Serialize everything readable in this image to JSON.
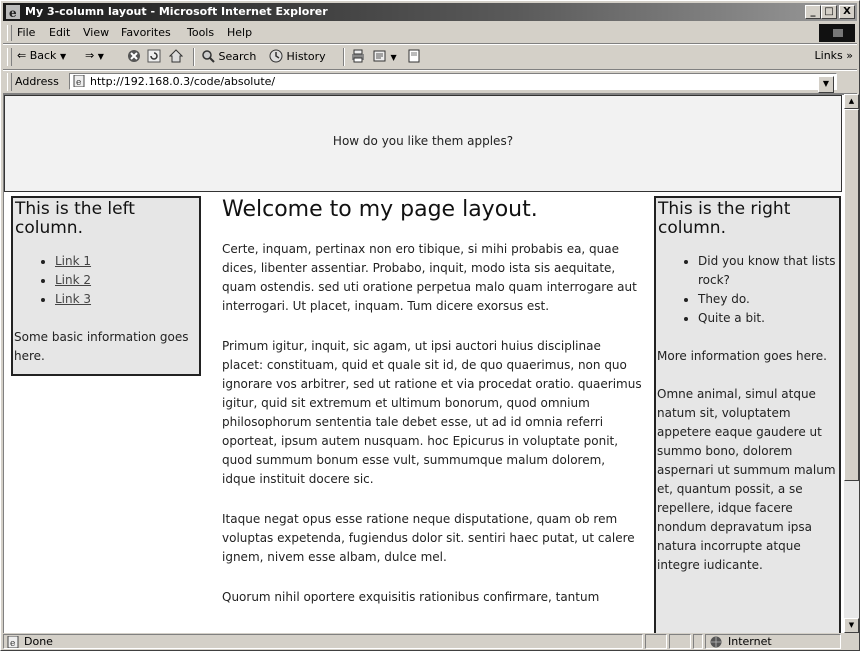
{
  "window": {
    "title": "My 3-column layout - Microsoft Internet Explorer",
    "minimize_glyph": "_",
    "maximize_glyph": "□",
    "close_glyph": "X"
  },
  "menu": [
    "File",
    "Edit",
    "View",
    "Favorites",
    "Tools",
    "Help"
  ],
  "toolbar": {
    "back_label": "Back",
    "forward_label": "⇒",
    "search_label": "Search",
    "history_label": "History",
    "links_label": "Links »"
  },
  "address": {
    "label": "Address",
    "url": "http://192.168.0.3/code/absolute/"
  },
  "page": {
    "banner_text": "How do you like them apples?",
    "left": {
      "heading": "This is the left column.",
      "links": [
        "Link 1",
        "Link 2",
        "Link 3"
      ],
      "info": "Some basic information goes here."
    },
    "main": {
      "heading": "Welcome to my page layout.",
      "paragraphs": [
        "Certe, inquam, pertinax non ero tibique, si mihi probabis ea, quae dices, libenter assentiar. Probabo, inquit, modo ista sis aequitate, quam ostendis. sed uti oratione perpetua malo quam interrogare aut interrogari. Ut placet, inquam. Tum dicere exorsus est.",
        "Primum igitur, inquit, sic agam, ut ipsi auctori huius disciplinae placet: constituam, quid et quale sit id, de quo quaerimus, non quo ignorare vos arbitrer, sed ut ratione et via procedat oratio. quaerimus igitur, quid sit extremum et ultimum bonorum, quod omnium philosophorum sententia tale debet esse, ut ad id omnia referri oporteat, ipsum autem nusquam. hoc Epicurus in voluptate ponit, quod summum bonum esse vult, summumque malum dolorem, idque instituit docere sic.",
        "Itaque negat opus esse ratione neque disputatione, quam ob rem voluptas expetenda, fugiendus dolor sit. sentiri haec putat, ut calere ignem, nivem esse albam, dulce mel.",
        "Quorum nihil oportere exquisitis rationibus confirmare, tantum"
      ]
    },
    "right": {
      "heading": "This is the right column.",
      "items": [
        "Did you know that lists rock?",
        "They do.",
        "Quite a bit."
      ],
      "info": "More information goes here.",
      "body": "Omne animal, simul atque natum sit, voluptatem appetere eaque gaudere ut summo bono, dolorem aspernari ut summum malum et, quantum possit, a se repellere, idque facere nondum depravatum ipsa natura incorrupte atque integre iudicante."
    }
  },
  "status": {
    "text": "Done",
    "zone": "Internet"
  }
}
